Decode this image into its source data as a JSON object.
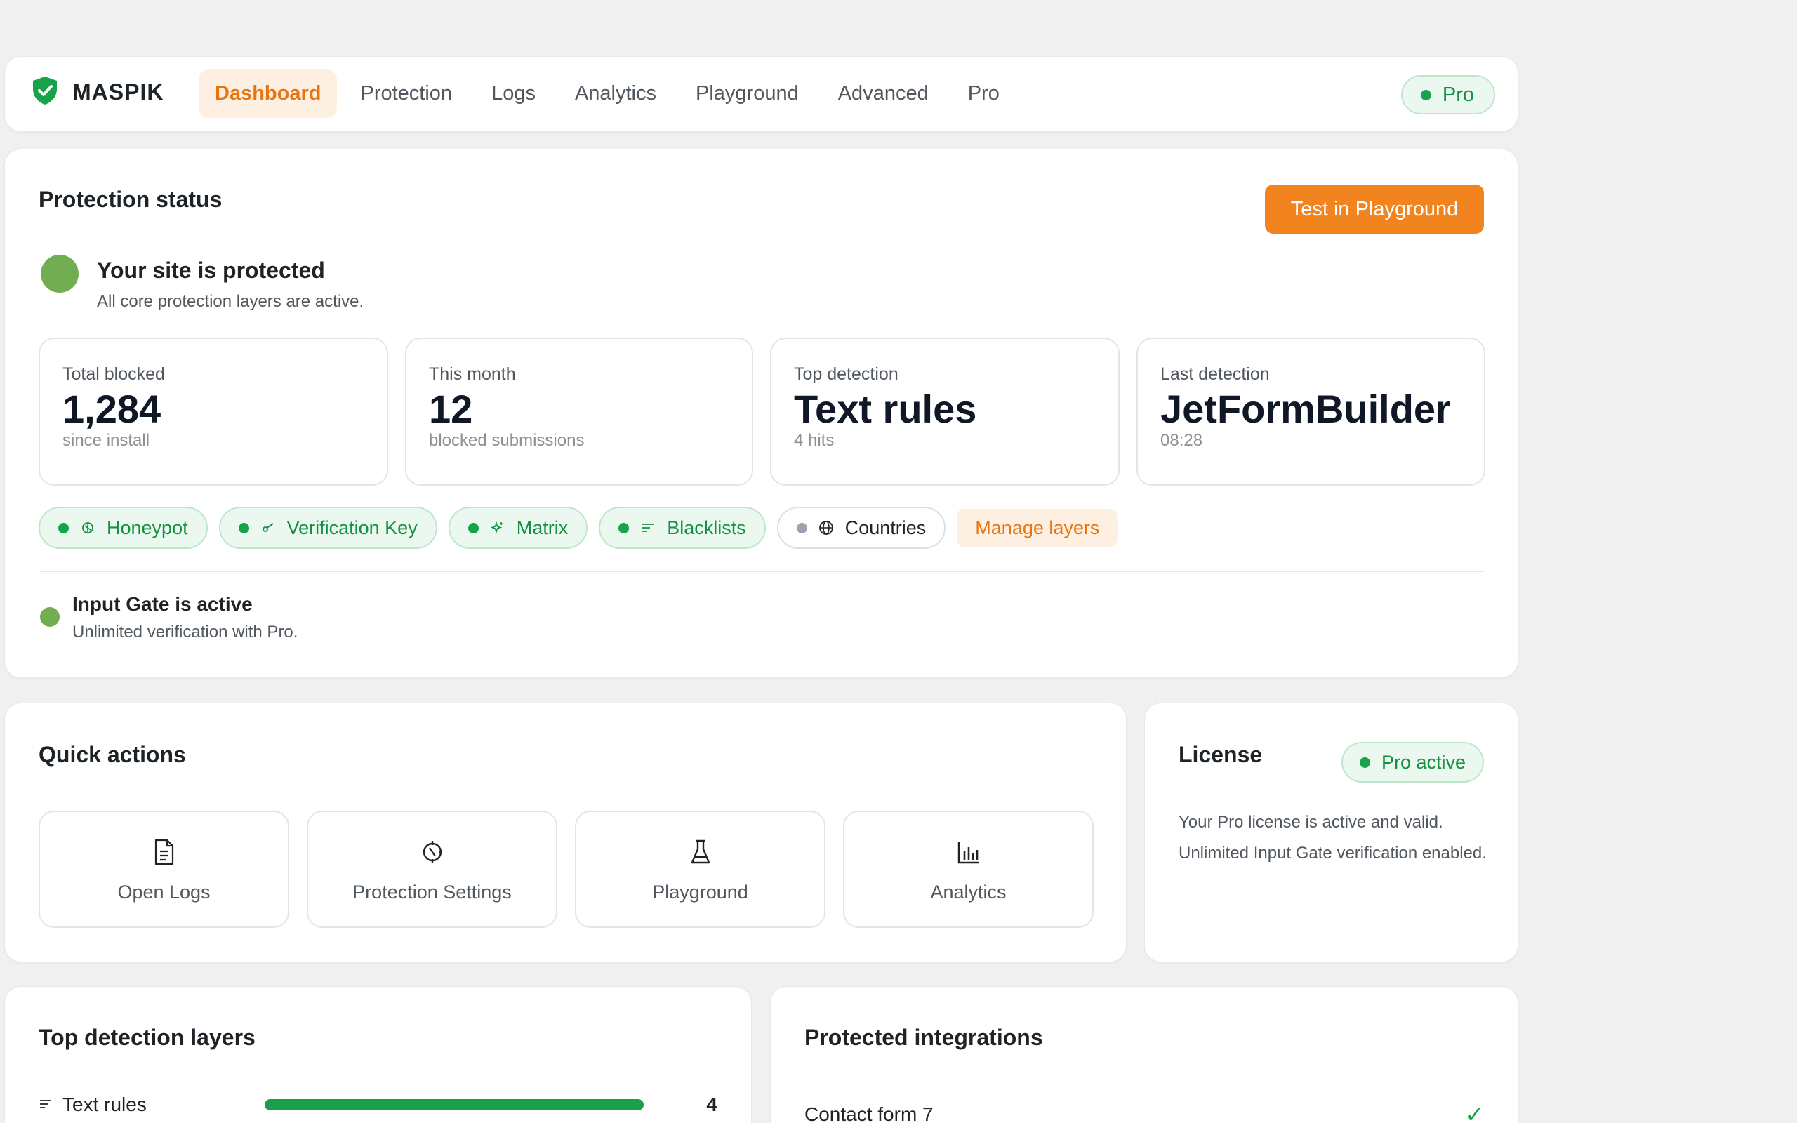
{
  "nav": {
    "brand": "MASPIK",
    "tabs": [
      {
        "label": "Dashboard",
        "active": true
      },
      {
        "label": "Protection"
      },
      {
        "label": "Logs"
      },
      {
        "label": "Analytics"
      },
      {
        "label": "Playground"
      },
      {
        "label": "Advanced"
      },
      {
        "label": "Pro"
      }
    ],
    "plan_badge": "Pro"
  },
  "status": {
    "title": "Protection status",
    "test_button": "Test in Playground",
    "headline": "Your site is protected",
    "subline": "All core protection layers are active.",
    "stats": [
      {
        "label": "Total blocked",
        "value": "1,284",
        "sub": "since install"
      },
      {
        "label": "This month",
        "value": "12",
        "sub": "blocked submissions"
      },
      {
        "label": "Top detection",
        "value": "Text rules",
        "sub": "4 hits"
      },
      {
        "label": "Last detection",
        "value": "JetFormBuilder",
        "sub": "08:28"
      }
    ],
    "layers": [
      {
        "label": "Honeypot",
        "active": true,
        "icon": "honeypot-icon"
      },
      {
        "label": "Verification Key",
        "active": true,
        "icon": "key-icon"
      },
      {
        "label": "Matrix",
        "active": true,
        "icon": "sparkle-icon"
      },
      {
        "label": "Blacklists",
        "active": true,
        "icon": "list-icon"
      },
      {
        "label": "Countries",
        "active": false,
        "icon": "globe-icon"
      }
    ],
    "manage_layers": "Manage layers",
    "gate_title": "Input Gate is active",
    "gate_sub": "Unlimited verification with Pro."
  },
  "quick_actions": {
    "title": "Quick actions",
    "items": [
      {
        "label": "Open Logs",
        "icon": "document-icon"
      },
      {
        "label": "Protection Settings",
        "icon": "shield-gear-icon"
      },
      {
        "label": "Playground",
        "icon": "flask-icon"
      },
      {
        "label": "Analytics",
        "icon": "bar-chart-icon"
      }
    ]
  },
  "license": {
    "title": "License",
    "badge": "Pro active",
    "line1": "Your Pro license is active and valid.",
    "line2": "Unlimited Input Gate verification enabled."
  },
  "top_detection": {
    "title": "Top detection layers",
    "rows": [
      {
        "label": "Text rules",
        "count": "4",
        "fraction": 1.0
      }
    ]
  },
  "integrations": {
    "title": "Protected integrations",
    "rows": [
      {
        "label": "Contact form 7",
        "status": "✓"
      }
    ]
  },
  "colors": {
    "accent": "#f2841f",
    "success": "#16a34a",
    "status_dot": "#72ad52"
  }
}
